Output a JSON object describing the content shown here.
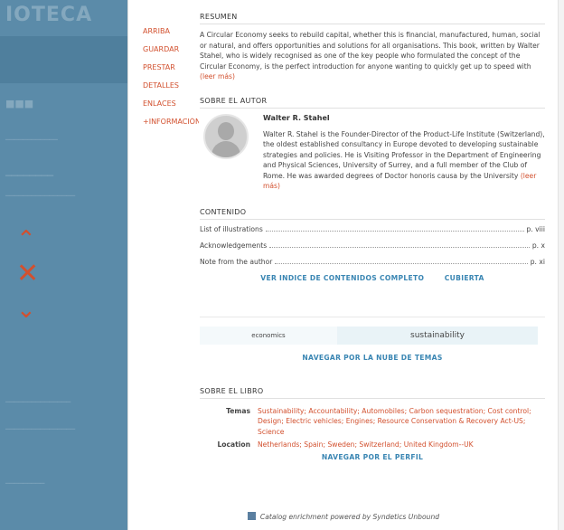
{
  "background": {
    "logo": "IOTECA",
    "accent": "#d2502e",
    "link": "#3a86b3",
    "sidebar_color": "#5b8ba9"
  },
  "menu": [
    "ARRIBA",
    "GUARDAR",
    "PRESTAR",
    "DETALLES",
    "ENLACES",
    "+INFORMACIÓN"
  ],
  "resumen": {
    "title": "RESUMEN",
    "text": "A Circular Economy seeks to rebuild capital, whether this is financial, manufactured, human, social or natural, and offers opportunities and solutions for all organisations. This book, written by Walter Stahel, who is widely recognised as one of the key people who formulated the concept of the Circular Economy, is the perfect introduction for anyone wanting to quickly get up to speed with",
    "more": "(leer más)"
  },
  "autor": {
    "title": "SOBRE EL AUTOR",
    "name": "Walter R. Stahel",
    "bio": "Walter R. Stahel is the Founder-Director of the Product-Life Institute (Switzerland), the oldest established consultancy in Europe devoted to developing sustainable strategies and policies. He is Visiting Professor in the Department of Engineering and Physical Sciences, University of Surrey, and a full member of the Club of Rome. He was awarded degrees of Doctor honoris causa by the University",
    "more": "(leer más)"
  },
  "contenido": {
    "title": "CONTENIDO",
    "rows": [
      {
        "label": "List of illustrations",
        "page": "p. viii"
      },
      {
        "label": "Acknowledgements",
        "page": "p. x"
      },
      {
        "label": "Note from the author",
        "page": "p. xi"
      }
    ],
    "link_full": "VER INDICE DE CONTENIDOS COMPLETO",
    "link_cover": "CUBIERTA"
  },
  "nube": {
    "tags": [
      "economics",
      "sustainability"
    ],
    "link": "NAVEGAR POR LA NUBE DE TEMAS"
  },
  "libro": {
    "title": "SOBRE EL LIBRO",
    "temas_label": "Temas",
    "temas": "Sustainability; Accountability; Automobiles; Carbon sequestration; Cost control; Design; Electric vehicles; Engines; Resource Conservation & Recovery Act-US; Science",
    "location_label": "Location",
    "location": "Netherlands; Spain; Sweden; Switzerland; United Kingdom--UK",
    "link": "NAVEGAR POR EL PERFIL"
  },
  "footer": "Catalog enrichment powered by Syndetics Unbound"
}
